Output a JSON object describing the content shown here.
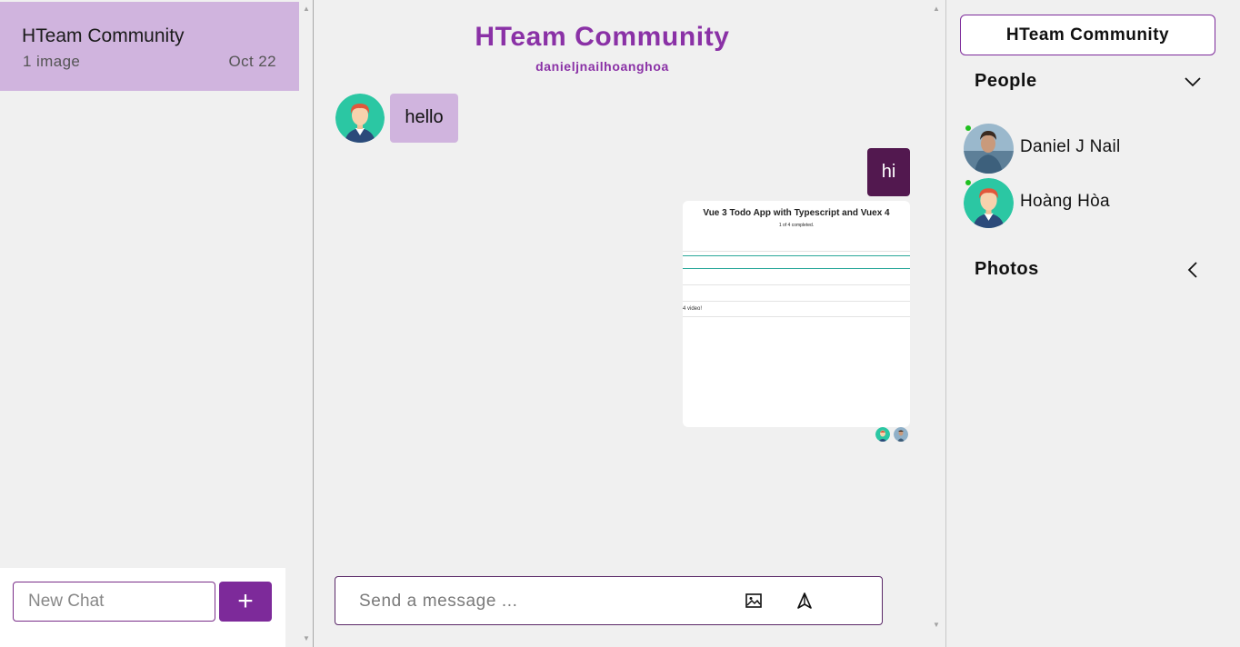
{
  "chat_list": {
    "items": [
      {
        "title": "HTeam Community",
        "subtitle": "1 image",
        "date": "Oct 22"
      }
    ],
    "new_chat_placeholder": "New Chat",
    "new_chat_button": "+"
  },
  "conversation": {
    "title": "HTeam Community",
    "subtitle": "danieljnailhoanghoa",
    "messages": [
      {
        "from": "Hoàng Hòa",
        "direction": "incoming",
        "text": "hello"
      },
      {
        "from": "me",
        "direction": "outgoing",
        "text": "hi"
      },
      {
        "from": "me",
        "direction": "outgoing",
        "type": "image",
        "image_title": "Vue 3 Todo App with Typescript and Vuex 4",
        "image_subtitle": "1 of 4 completed.",
        "image_text": "4 video!"
      }
    ],
    "composer_placeholder": "Send a message ..."
  },
  "details": {
    "title": "HTeam Community",
    "people_label": "People",
    "people": [
      {
        "name": "Daniel J Nail",
        "online": true
      },
      {
        "name": "Hoàng Hòa",
        "online": true
      }
    ],
    "photos_label": "Photos"
  },
  "colors": {
    "accent": "#8a31a6",
    "selected_chat": "#d0b4de",
    "outgoing_bubble": "#52184f",
    "online_dot": "#1fc01f"
  },
  "icons": [
    "plus-icon",
    "image-icon",
    "send-icon",
    "chevron-down-icon",
    "chevron-left-icon"
  ]
}
